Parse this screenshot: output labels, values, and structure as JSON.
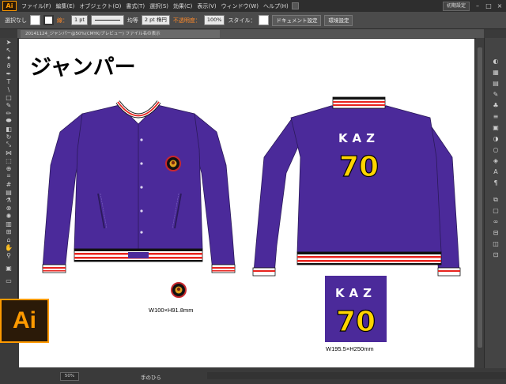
{
  "app": {
    "badge": "Ai",
    "workspace_label": "初期設定"
  },
  "menu": [
    "ファイル(F)",
    "編集(E)",
    "オブジェクト(O)",
    "書式(T)",
    "選択(S)",
    "効果(C)",
    "表示(V)",
    "ウィンドウ(W)",
    "ヘルプ(H)"
  ],
  "control": {
    "selection": "選択なし",
    "stroke_label": "線：",
    "stroke_weight": "1 pt",
    "profile_label": "均等",
    "brush_label": "2 pt 楕円",
    "opacity_label": "不透明度：",
    "opacity_value": "100%",
    "style_label": "スタイル：",
    "doc_settings": "ドキュメント設定",
    "prefs": "環境設定"
  },
  "doc_tab": "20141124_ジャンパー@50%(CMYK/プレビュー) ファイル名の表示",
  "canvas": {
    "heading": "ジャンパー",
    "emblem_caption": "W100×H91.8mm",
    "back_caption": "W195.5×H250mm",
    "back_name": "KAZ",
    "back_number": "70",
    "jacket_color": "#4b2a9a"
  },
  "status": {
    "zoom": "50%",
    "tool_name": "手のひら"
  }
}
